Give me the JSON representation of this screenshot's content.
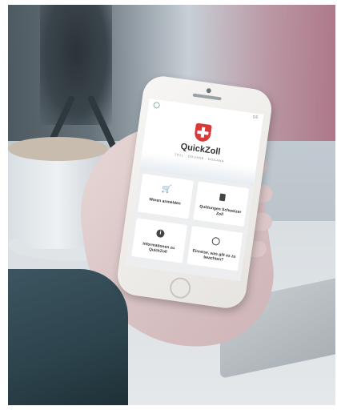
{
  "app": {
    "title": "QuickZoll",
    "subtitle": "ZOLL · DOUANE · DOGANA",
    "language": "DE"
  },
  "tiles": [
    {
      "label": "Waren anmelden",
      "icon": "shopping-cart-icon"
    },
    {
      "label": "Quittungen Schweizer Zoll",
      "icon": "document-icon"
    },
    {
      "label": "Informationen zu QuickZoll",
      "icon": "info-icon"
    },
    {
      "label": "Einreise, was gilt es zu beachten?",
      "icon": "speech-bubble-icon"
    }
  ],
  "colors": {
    "brand_red": "#d83a3a",
    "tile_background": "#ffffff",
    "screen_background": "#eceeef"
  }
}
